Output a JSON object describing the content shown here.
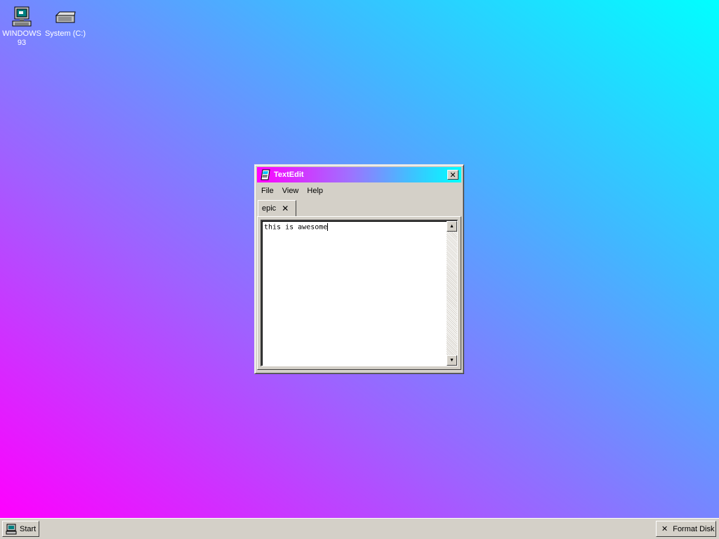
{
  "desktop": {
    "icons": [
      {
        "label": "WINDOWS 93",
        "icon": "computer-icon"
      },
      {
        "label": "System (C:)",
        "icon": "drive-icon"
      }
    ]
  },
  "window": {
    "title": "TextEdit",
    "title_icon": "textedit-icon",
    "close_label": "✕",
    "menu": [
      "File",
      "View",
      "Help"
    ],
    "tabs": [
      {
        "label": "epic",
        "close_label": "✕"
      }
    ],
    "editor": {
      "content": "this is awesome"
    },
    "titlebar_gradient": [
      "#ff00ff",
      "#00ffff"
    ]
  },
  "taskbar": {
    "start_label": "Start",
    "buttons": [
      {
        "label": "Format Disk",
        "icon_label": "✕"
      }
    ]
  },
  "colors": {
    "desktop_gradient": [
      "#ff00ff",
      "#a060ff",
      "#40b8ff",
      "#00ffff"
    ],
    "chrome": "#d4d0c8"
  }
}
